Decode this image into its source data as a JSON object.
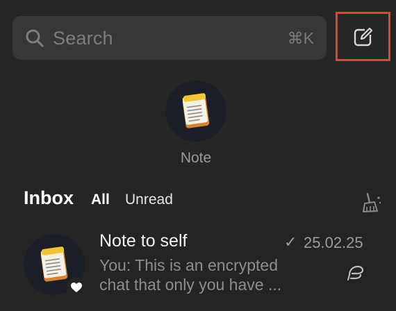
{
  "search": {
    "placeholder": "Search",
    "shortcut": "⌘K",
    "icon": "search-icon"
  },
  "toolbar": {
    "compose_icon": "compose-icon",
    "highlight_color": "#e0462c"
  },
  "stories": [
    {
      "label": "Note",
      "icon": "notepad-icon"
    }
  ],
  "inbox": {
    "title": "Inbox",
    "tabs": [
      {
        "label": "All",
        "selected": true
      },
      {
        "label": "Unread",
        "selected": false
      }
    ],
    "clean_icon": "broom-icon"
  },
  "chats": [
    {
      "name": "Note to self",
      "status_icon": "✓",
      "date": "25.02.25",
      "preview_line1": "You: This is an encrypted",
      "preview_line2": "chat that only you have ...",
      "badge_icon": "heart-icon",
      "side_icon": "draft-icon"
    }
  ]
}
